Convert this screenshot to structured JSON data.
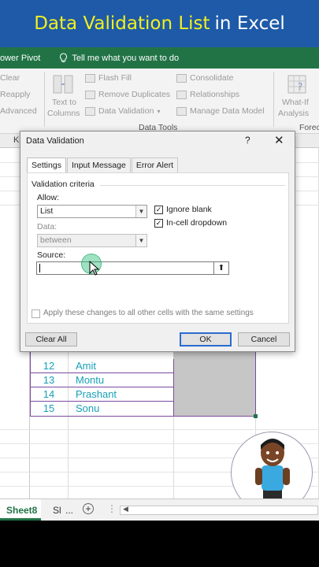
{
  "banner": {
    "highlight": "Data Validation List",
    "rest": "in Excel"
  },
  "ribbon_tabs": {
    "power_pivot": "ower Pivot",
    "tell_me": "Tell me what you want to do"
  },
  "ribbon": {
    "clear": "Clear",
    "reapply": "Reapply",
    "advanced": "Advanced",
    "text_to": "Text to",
    "columns": "Columns",
    "flash_fill": "Flash Fill",
    "remove_duplicates": "Remove Duplicates",
    "data_validation": "Data Validation",
    "consolidate": "Consolidate",
    "relationships": "Relationships",
    "manage_data_model": "Manage Data Model",
    "what_if": "What-If",
    "analysis": "Analysis",
    "forecast": "Forec",
    "group_label": "Data Tools"
  },
  "grid": {
    "col_fragment": "K",
    "rows": [
      {
        "num": "12",
        "name": "Amit"
      },
      {
        "num": "13",
        "name": "Montu"
      },
      {
        "num": "14",
        "name": "Prashant"
      },
      {
        "num": "15",
        "name": "Sonu"
      }
    ]
  },
  "sheet_tabs": {
    "active": "Sheet8",
    "next": "Sl",
    "more": "...",
    "add": "+"
  },
  "dialog": {
    "title": "Data Validation",
    "help": "?",
    "close": "✕",
    "tabs": [
      "Settings",
      "Input Message",
      "Error Alert"
    ],
    "criteria_title": "Validation criteria",
    "allow_label": "Allow:",
    "allow_value": "List",
    "data_label": "Data:",
    "data_value": "between",
    "ignore_blank": "Ignore blank",
    "in_cell_dropdown": "In-cell dropdown",
    "source_label": "Source:",
    "source_value": "",
    "apply_all": "Apply these changes to all other cells with the same settings",
    "clear_all": "Clear All",
    "ok": "OK",
    "cancel": "Cancel"
  },
  "colors": {
    "banner_bg": "#1e5aa8",
    "banner_highlight": "#f2f01e",
    "excel_green": "#217346",
    "table_border": "#7b4a9e",
    "cell_text": "#18a0b8"
  }
}
